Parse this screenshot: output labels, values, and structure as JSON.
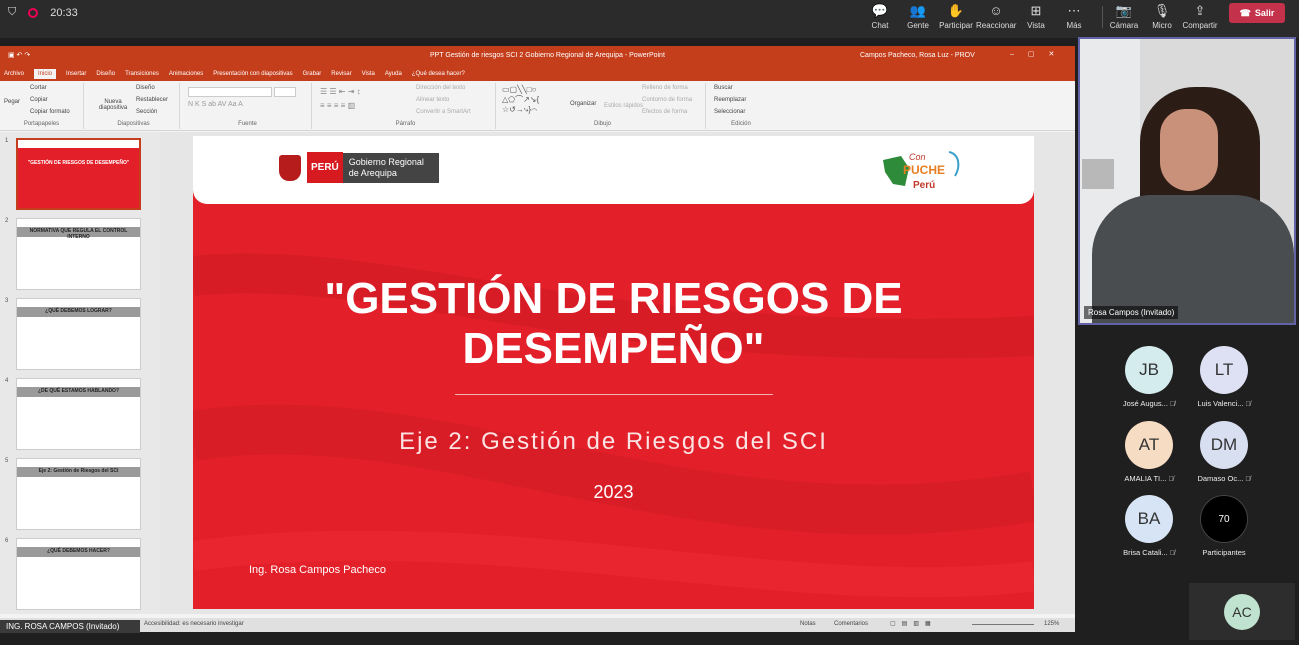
{
  "top_bar": {
    "clock": "20:33",
    "buttons": [
      {
        "icon": "chat-icon",
        "label": "Chat",
        "glyph": "💬"
      },
      {
        "icon": "people-icon",
        "label": "Gente",
        "glyph": "👥"
      },
      {
        "icon": "raise-hand-icon",
        "label": "Participar",
        "glyph": "✋"
      },
      {
        "icon": "reaction-icon",
        "label": "Reaccionar",
        "glyph": "☺"
      },
      {
        "icon": "view-icon",
        "label": "Vista",
        "glyph": "⊞"
      },
      {
        "icon": "more-icon",
        "label": "Más",
        "glyph": "⋯"
      },
      {
        "icon": "camera-icon",
        "label": "Cámara",
        "glyph": "📷"
      },
      {
        "icon": "mic-icon",
        "label": "Micro",
        "glyph": "🎙"
      },
      {
        "icon": "share-icon",
        "label": "Compartir",
        "glyph": "⇪"
      }
    ],
    "leave_label": "Salir"
  },
  "powerpoint": {
    "title": "PPT Gestión de riesgos SCI 2 Gobierno Regional de Arequipa - PowerPoint",
    "user": "Campos Pacheco, Rosa Luz - PROV",
    "tabs": [
      "Archivo",
      "Inicio",
      "Insertar",
      "Diseño",
      "Transiciones",
      "Animaciones",
      "Presentación con diapositivas",
      "Grabar",
      "Revisar",
      "Vista",
      "Ayuda",
      "¿Qué desea hacer?"
    ],
    "ribbon": {
      "clipboard": {
        "paste": "Pegar",
        "cut": "Cortar",
        "copy": "Copiar",
        "format": "Copiar formato",
        "label": "Portapapeles"
      },
      "slides": {
        "new": "Nueva diapositiva",
        "layout": "Diseño",
        "reset": "Restablecer",
        "section": "Sección",
        "label": "Diapositivas"
      },
      "font_label": "Fuente",
      "paragraph": {
        "label": "Párrafo",
        "text_dir": "Dirección del texto",
        "align": "Alinear texto",
        "smartart": "Convertir a SmartArt"
      },
      "drawing": {
        "arrange": "Organizar",
        "styles": "Estilos rápidos",
        "fill": "Relleno de forma",
        "outline": "Contorno de forma",
        "effects": "Efectos de forma",
        "label": "Dibujo"
      },
      "editing": {
        "find": "Buscar",
        "replace": "Reemplazar",
        "select": "Seleccionar",
        "label": "Edición"
      }
    },
    "thumbnails": [
      {
        "num": "1",
        "title": "\"GESTIÓN DE RIESGOS DE DESEMPEÑO\""
      },
      {
        "num": "2",
        "title": "NORMATIVA QUE REGULA EL CONTROL INTERNO"
      },
      {
        "num": "3",
        "title": "¿QUÉ DEBEMOS LOGRAR?"
      },
      {
        "num": "4",
        "title": "¿DE QUÉ ESTAMOS HABLANDO?"
      },
      {
        "num": "5",
        "title": "Eje 2: Gestión de Riesgos del SCI"
      },
      {
        "num": "6",
        "title": "¿QUÉ DEBEMOS HACER?"
      }
    ],
    "slide": {
      "org_badge": "PERÚ",
      "org_name": "Gobierno Regional de Arequipa",
      "logo_text": "Con PUCHE Perú",
      "title_line1": "\"GESTIÓN DE RIESGOS DE",
      "title_line2": "DESEMPEÑO\"",
      "subtitle": "Eje 2: Gestión de Riesgos del SCI",
      "year": "2023",
      "author": "Ing. Rosa Campos Pacheco"
    },
    "status": {
      "accessibility": "Accesibilidad: es necesario investigar",
      "notes": "Notas",
      "comments": "Comentarios",
      "zoom": "125%"
    }
  },
  "presenter_label": "ING. ROSA CAMPOS (Invitado)",
  "video": {
    "name": "Rosa Campos (Invitado)"
  },
  "participants": [
    {
      "initials": "JB",
      "name": "José Augus...",
      "color": "#d5ecef"
    },
    {
      "initials": "LT",
      "name": "Luis Valenci...",
      "color": "#dde1f3"
    },
    {
      "initials": "AT",
      "name": "AMALIA TI...",
      "color": "#f7dcc4"
    },
    {
      "initials": "DM",
      "name": "Damaso Oc...",
      "color": "#d8dff0"
    },
    {
      "initials": "BA",
      "name": "Brisa Catali...",
      "color": "#d7e4f5"
    }
  ],
  "participants_count": "70",
  "participants_label": "Participantes",
  "self_initials": "AC"
}
